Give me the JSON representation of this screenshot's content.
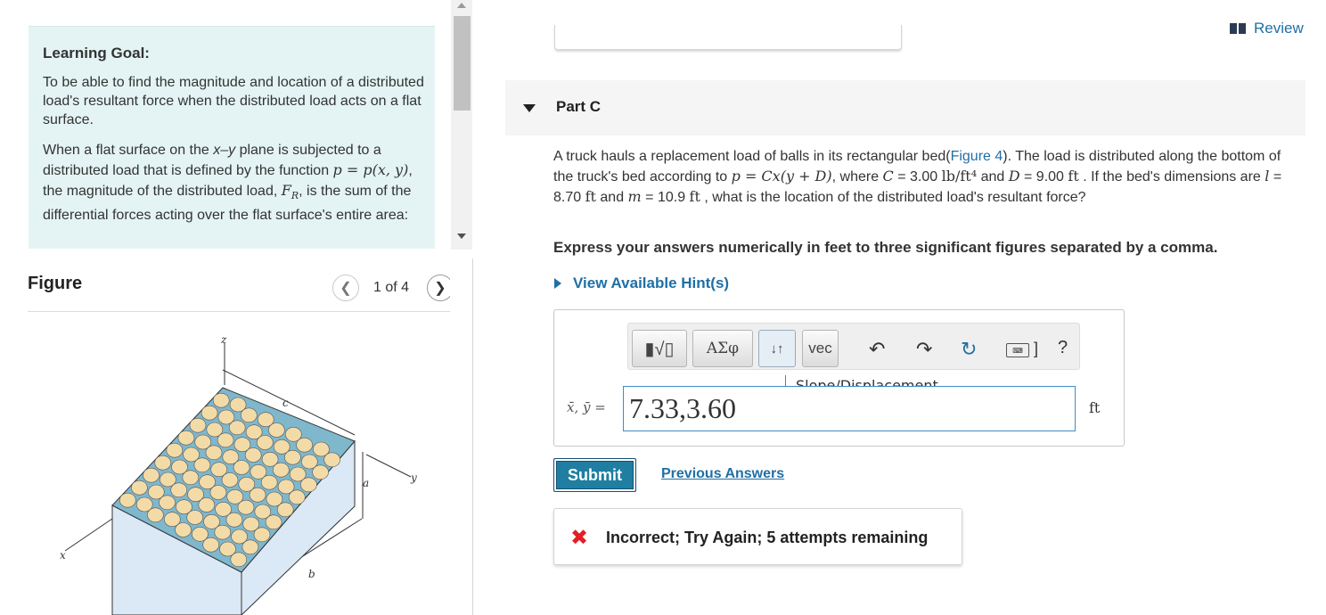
{
  "learning_goal": {
    "heading": "Learning Goal:",
    "paragraph1": "To be able to find the magnitude and location of a distributed load's resultant force when the distributed load acts on a flat surface.",
    "p2_part1": "When a flat surface on the ",
    "p2_xy": "x–y",
    "p2_part2": " plane is subjected to a distributed load that is defined by the function ",
    "p2_func": "p = p(x, y)",
    "p2_part3": ", the magnitude of the distributed load, ",
    "p2_fr": "F",
    "p2_fr_sub": "R",
    "p2_part4": ", is the sum of the differential forces acting over the flat surface's entire area:"
  },
  "figure": {
    "title": "Figure",
    "counter": "1 of 4",
    "prev_icon": "chevron-left-icon",
    "next_icon": "chevron-right-icon",
    "labels": {
      "z": "z",
      "c": "c",
      "a": "a",
      "y": "y",
      "x": "x",
      "b": "b"
    },
    "colors": {
      "bed_fill": "#dbe8f6",
      "ball_fill": "#f3dba8",
      "bed_floor": "#7fb7cc"
    }
  },
  "review": {
    "label": "Review",
    "icon": "book-icon"
  },
  "part": {
    "label": "Part C"
  },
  "question": {
    "t1": "A truck hauls a replacement load of balls in its rectangular bed(",
    "figure_link": "Figure 4",
    "t2": "). The load is distributed along the bottom of the truck's bed according to ",
    "formula": "p = Cx(y + D)",
    "t3": ", where ",
    "c_sym": "C",
    "c_val": " = 3.00 ",
    "c_unit": "lb/ft⁴",
    "t4": " and ",
    "d_sym": "D",
    "d_val": " = 9.00 ",
    "d_unit": "ft",
    "t5": " . If the bed's dimensions are ",
    "l_sym": "l",
    "l_val": " = 8.70 ",
    "l_unit": "ft",
    "t6": " and ",
    "m_sym": "m",
    "m_val": " = 10.9 ",
    "m_unit": "ft",
    "t7": " , what is the location of the distributed load's resultant force?"
  },
  "instruction": "Express your answers numerically in feet to three significant figures separated by a comma.",
  "hints": {
    "label": "View Available Hint(s)"
  },
  "toolbar": {
    "templates": "▮√▯",
    "greek": "ΑΣφ",
    "updown": "↓↑",
    "vec": "vec",
    "undo": "↶",
    "redo": "↷",
    "reset": "↻",
    "keyboard": "⌨",
    "keyboard_bracket": "]",
    "help": "?"
  },
  "tooltip": "Slope/Displacement",
  "answer": {
    "variable_label": "x̄, ȳ =",
    "value": "7.33,3.60",
    "unit": "ft"
  },
  "submit": {
    "label": "Submit"
  },
  "previous_answers": {
    "label": "Previous Answers"
  },
  "feedback": {
    "icon": "✖",
    "text": "Incorrect; Try Again; 5 attempts remaining",
    "color": "#e21f26"
  },
  "colors": {
    "accent": "#1f6fa5",
    "goal_bg": "#e4f4f4",
    "submit_bg": "#1f7ea1"
  }
}
